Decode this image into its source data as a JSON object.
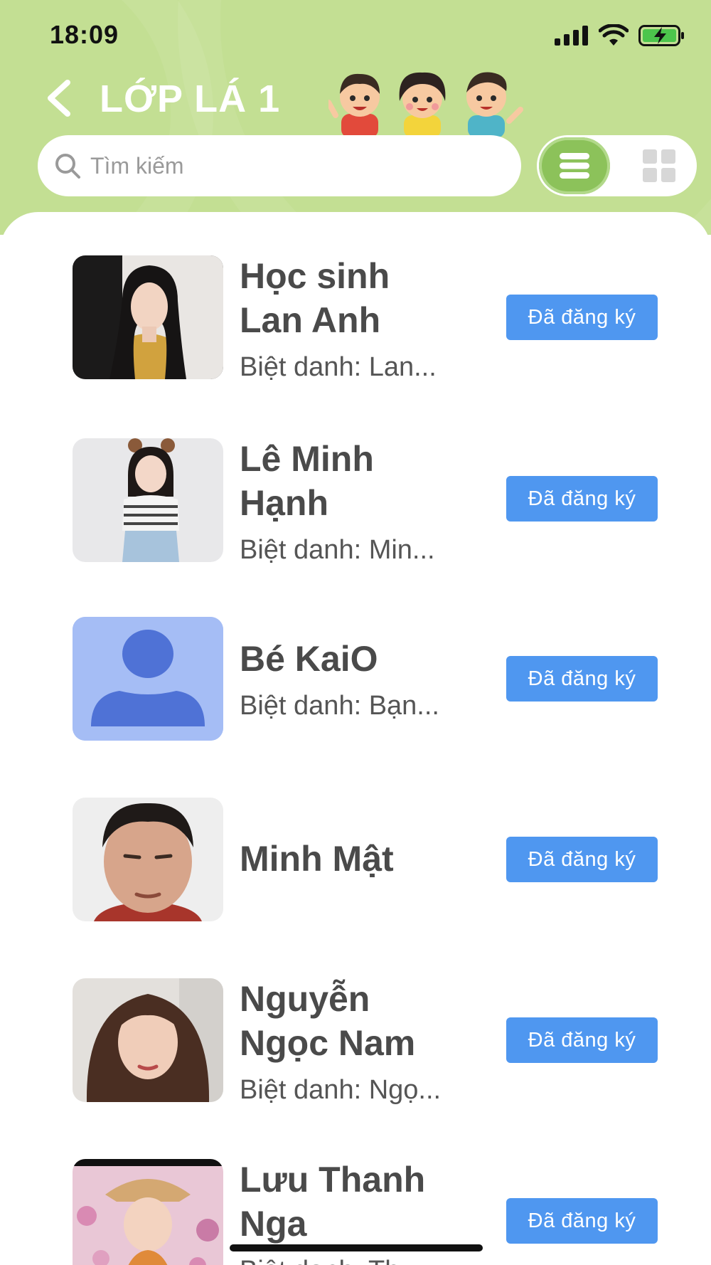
{
  "status_bar": {
    "time": "18:09"
  },
  "header": {
    "title": "LỚP LÁ 1"
  },
  "search": {
    "placeholder": "Tìm kiếm"
  },
  "colors": {
    "header_green": "#c3df93",
    "toggle_green": "#8cc25a",
    "button_blue": "#4f97f0"
  },
  "students": [
    {
      "name_line1": "Học sinh",
      "name_line2": "Lan Anh",
      "nickname": "Biệt danh: Lan...",
      "status": "Đã đăng ký",
      "avatar": "photo-woman-dark-hair"
    },
    {
      "name_line1": "Lê Minh",
      "name_line2": "Hạnh",
      "nickname": "Biệt danh: Min...",
      "status": "Đã đăng ký",
      "avatar": "photo-girl-bear-ears"
    },
    {
      "name_line1": "Bé KaiO",
      "name_line2": "",
      "nickname": "Biệt danh: Bạn...",
      "status": "Đã đăng ký",
      "avatar": "default-person-placeholder"
    },
    {
      "name_line1": "Minh Mật",
      "name_line2": "",
      "nickname": "",
      "status": "Đã đăng ký",
      "avatar": "photo-man-face"
    },
    {
      "name_line1": "Nguyễn",
      "name_line2": "Ngọc Nam",
      "nickname": "Biệt danh: Ngọ...",
      "status": "Đã đăng ký",
      "avatar": "photo-woman-earphones"
    },
    {
      "name_line1": "Lưu Thanh",
      "name_line2": "Nga",
      "nickname": "Biệt danh: Th...",
      "status": "Đã đăng ký",
      "avatar": "photo-girl-flowers"
    }
  ]
}
